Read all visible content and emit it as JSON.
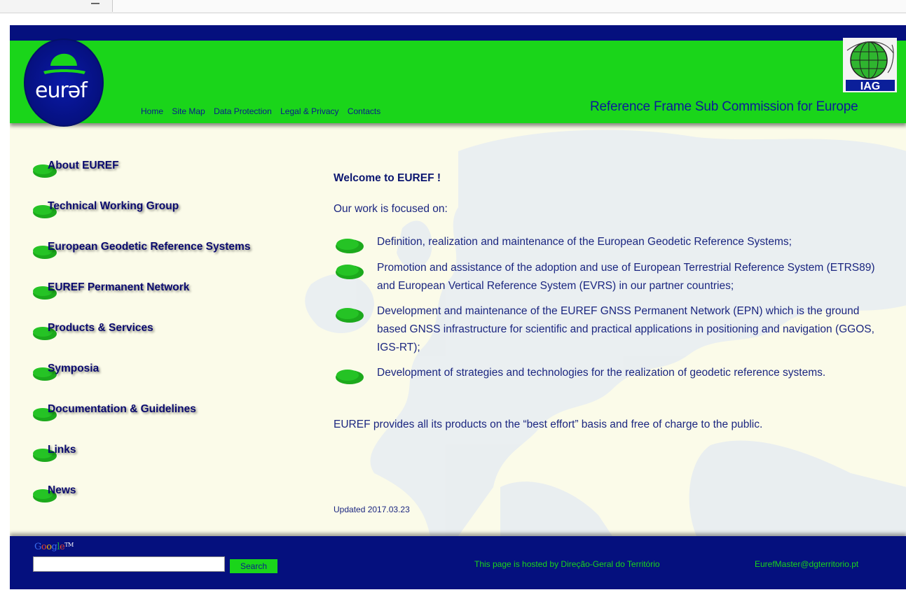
{
  "header": {
    "logo_text": "eurəf",
    "nav": [
      "Home",
      "Site Map",
      "Data Protection",
      "Legal & Privacy",
      "Contacts"
    ],
    "tagline": "Reference Frame Sub Commission for Europe",
    "iag_text": "IAG"
  },
  "sidebar": {
    "items": [
      {
        "label": "About EUREF"
      },
      {
        "label": "Technical Working Group"
      },
      {
        "label": "European Geodetic Reference Systems"
      },
      {
        "label": "EUREF Permanent Network"
      },
      {
        "label": "Products & Services"
      },
      {
        "label": "Symposia"
      },
      {
        "label": "Documentation & Guidelines"
      },
      {
        "label": "Links"
      },
      {
        "label": "News"
      }
    ]
  },
  "main": {
    "welcome": "Welcome to EUREF !",
    "intro": "Our work is focused on:",
    "bullets": [
      "Definition, realization and maintenance of the European Geodetic Reference Systems;",
      "Promotion and assistance of the adoption and use of European Terrestrial Reference System (ETRS89) and European Vertical Reference System (EVRS) in our partner countries;",
      "Development and maintenance of the EUREF GNSS Permanent Network (EPN) which is the ground based GNSS infrastructure for scientific and practical applications in positioning and navigation (GGOS, IGS-RT);",
      "Development of strategies and technologies for the realization of geodetic reference systems."
    ],
    "closing": "EUREF provides all its products on the “best effort” basis and free of charge to the public.",
    "updated": "Updated 2017.03.23"
  },
  "footer": {
    "google_letters": [
      "G",
      "o",
      "o",
      "g",
      "l",
      "e"
    ],
    "google_tm": "TM",
    "search_value": "",
    "search_label": "Search",
    "hosted": "This page is hosted by Direção-Geral do Território",
    "email": "EurefMaster@dgterritorio.pt"
  },
  "colors": {
    "green": "#1ad51a",
    "navy": "#05107e",
    "background": "#fbfbe9",
    "text": "#1b2680"
  }
}
